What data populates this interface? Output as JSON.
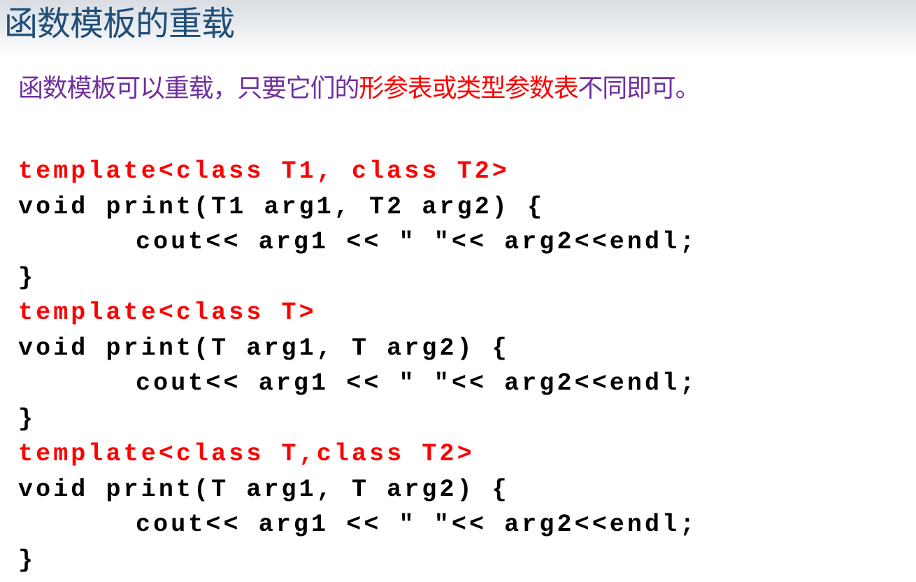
{
  "slide": {
    "title": "函数模板的重载",
    "intro": {
      "part1": "函数模板可以重载，只要它们的",
      "highlight": "形参表或类型参数表",
      "part2": "不同即可。"
    },
    "colors": {
      "title": "#1f4e79",
      "intro_text": "#7030a0",
      "highlight": "#ff0000",
      "template_line": "#ff0000",
      "code": "#000000"
    }
  },
  "code": {
    "lines": [
      "template<class T1, class T2>",
      "void print(T1 arg1, T2 arg2) {",
      "cout<< arg1 << \" \"<< arg2<<endl;",
      "}",
      "template<class T>",
      "void print(T arg1, T arg2) {",
      "cout<< arg1 << \" \"<< arg2<<endl;",
      "}",
      "template<class T,class T2>",
      "void print(T arg1, T arg2) {",
      "cout<< arg1 << \" \"<< arg2<<endl;",
      "}"
    ]
  }
}
